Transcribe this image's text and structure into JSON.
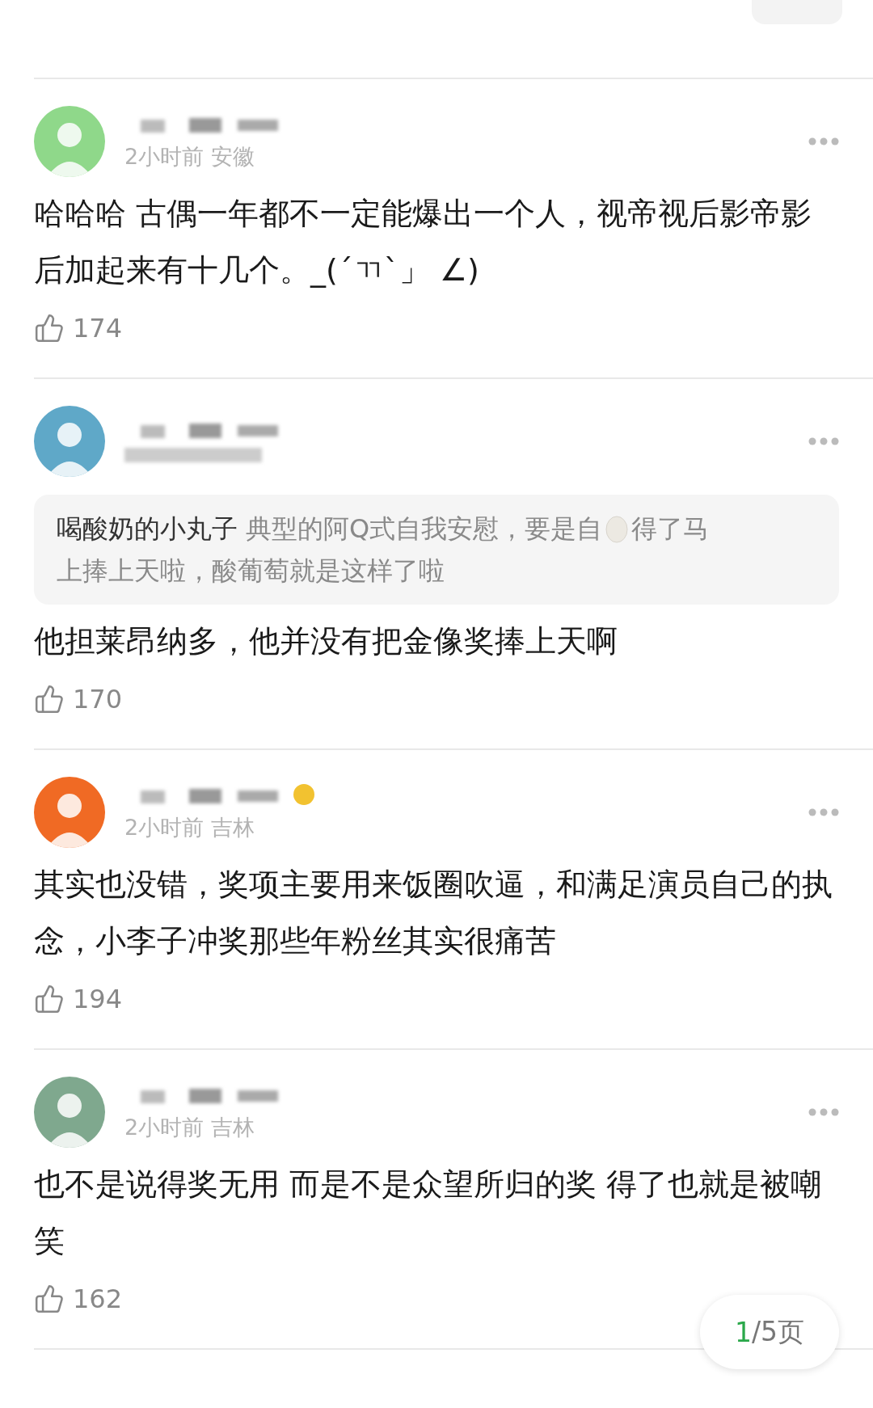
{
  "comments": [
    {
      "color": "#8fd88a",
      "meta": "2小时前 安徽",
      "body": "哈哈哈 古偶一年都不一定能爆出一个人，视帝视后影帝影后加起来有十几个。_(´ㄲ`」 ∠)",
      "likes": "174"
    },
    {
      "color": "#5fa8c8",
      "body": "他担莱昂纳多，他并没有把金像奖捧上天啊",
      "likes": "170",
      "reply": {
        "author": "喝酸奶的小丸子",
        "text_before": "典型的阿Q式自我安慰，要是自",
        "text_after": "得了马",
        "text_line2": "上捧上天啦，酸葡萄就是这样了啦"
      }
    },
    {
      "color": "#f06a24",
      "meta": "2小时前 吉林",
      "body": "其实也没错，奖项主要用来饭圈吹逼，和满足演员自己的执念，小李子冲奖那些年粉丝其实很痛苦",
      "likes": "194",
      "badge": true
    },
    {
      "color": "#7fa88e",
      "meta": "2小时前 吉林",
      "body": "也不是说得奖无用 而是不是众望所归的奖 得了也就是被嘲笑",
      "likes": "162"
    }
  ],
  "pager": {
    "current": "1",
    "total": "/5页"
  }
}
